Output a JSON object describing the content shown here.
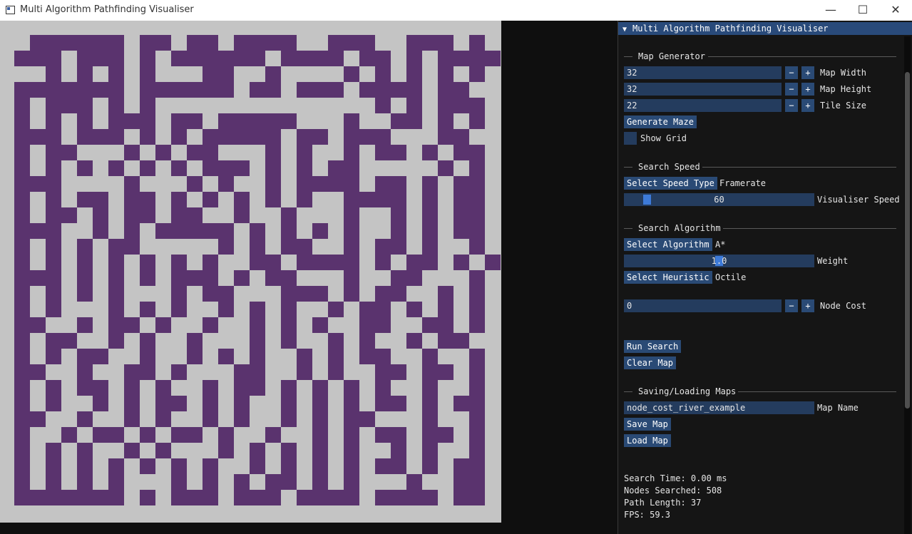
{
  "window": {
    "title": "Multi Algorithm Pathfinding Visualiser",
    "minimize": "—",
    "maximize": "☐",
    "close": "✕"
  },
  "maze": {
    "wall_color": "#5a336e",
    "floor_color": "#c4c4c4",
    "tiles": 32,
    "rows": [
      "................................",
      "..######.##.##.####..###..###.#.",
      ".###.###.#.######.####.##.#.####",
      "...#.#.#.#...##..#....#.#.#.#.#.",
      ".#######.######.##.###.####.##..",
      ".#.###.#.#..............#.#.###.",
      ".#.#.#.###.##.#####...#..##.#.#.",
      ".###.###.#.#.#####.##.###...##..",
      ".#.##...#.#.##...#.#..#.##.#.##.",
      ".#.#.#.#.#.#.###.#.#.##.....#.#.",
      ".###....#...#.#..#.####.##.#.##.",
      ".#.#.##.##.#.#.#.#.#..####.#.##.",
      ".#.##.#.##.##..#..#...#..#.#.##.",
      ".###..#.#.#####.#.#.#.#..#.#.##.",
      ".#.#.#.##.....#.#.##..#.##.#..#.",
      ".#.#.#.#.#.#.#..##.####.#.##.#.#",
      ".###.#.#.#.###.#.##...#..##...#.",
      ".#.#.#.#...#.##...###.#.##..#.#.",
      ".#.#...#.#.#..#.#.#..#.##.#.#.#.",
      ".##..#.##.#..#..#.#.#..##..##.#.",
      ".#.##..#.#..#...#.#..#.#..#.##..",
      ".#.#.##..#..#.#.#..#.#.##..#..#.",
      ".##..#..##.#...##..#.#..##.##.#.",
      ".#.#.##.#.#..#.##.#.#.#.#..#..#.",
      ".#.#..#.#.##.#.#..#.#.#.##.#.##.",
      ".##..#..#.#..#.#..#.#.##...#..#.",
      ".#..#.##.#.##.#..#..#.#.##.##.#.",
      ".#.#.#..#.#...#.#.#.#.#..#.#..#.",
      ".#.#.#.#.#.#.#..#.#.#.#.##.#.##.",
      ".#.#.#.#...#.#.#.##.#.#...#..##.",
      ".#######.#.###.###.####.####.##.",
      "................................"
    ]
  },
  "panel": {
    "header": "Multi Algorithm Pathfinding Visualiser",
    "map_generator": {
      "title": "Map Generator",
      "width_value": "32",
      "width_label": "Map Width",
      "height_value": "32",
      "height_label": "Map Height",
      "tile_value": "22",
      "tile_label": "Tile Size",
      "minus": "−",
      "plus": "+",
      "generate": "Generate Maze",
      "show_grid": "Show Grid"
    },
    "search_speed": {
      "title": "Search Speed",
      "select": "Select Speed Type",
      "speed_type": "Framerate",
      "speed_value": "60",
      "speed_fraction": 0.1,
      "speed_label": "Visualiser Speed"
    },
    "search_algorithm": {
      "title": "Search Algorithm",
      "select": "Select Algorithm",
      "algorithm": "A*",
      "weight_value": "1.0",
      "weight_fraction": 0.5,
      "weight_label": "Weight",
      "select_heuristic": "Select Heuristic",
      "heuristic": "Octile",
      "node_cost_value": "0",
      "node_cost_label": "Node Cost",
      "run": "Run Search",
      "clear": "Clear Map"
    },
    "saving": {
      "title": "Saving/Loading Maps",
      "map_name_value": "node_cost_river_example",
      "map_name_label": "Map Name",
      "save": "Save Map",
      "load": "Load Map"
    },
    "stats": {
      "search_time": "Search Time: 0.00 ms",
      "nodes_searched": "Nodes Searched: 508",
      "path_length": "Path Length: 37",
      "fps": "FPS: 59.3"
    }
  }
}
